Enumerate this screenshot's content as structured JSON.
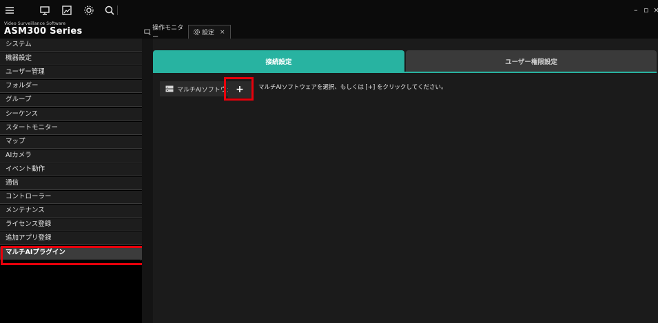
{
  "app": {
    "subtitle": "Video Surveillance Software",
    "title": "ASM300 Series"
  },
  "topbar": {
    "icons": [
      "menu-icon",
      "monitor-icon",
      "image-icon",
      "gear-icon",
      "search-icon"
    ],
    "window_controls": {
      "minimize": "–",
      "maximize": "▫",
      "close": "×"
    }
  },
  "tabs": [
    {
      "label": "操作モニター",
      "icon": "monitor-icon"
    },
    {
      "label": "設定",
      "icon": "gear-icon",
      "close": "×"
    }
  ],
  "sidebar": {
    "items": [
      {
        "label": "システム"
      },
      {
        "label": "機器設定"
      },
      {
        "label": "ユーザー管理"
      },
      {
        "label": "フォルダー"
      },
      {
        "label": "グループ"
      },
      {
        "label": "シーケンス"
      },
      {
        "label": "スタートモニター"
      },
      {
        "label": "マップ"
      },
      {
        "label": "AIカメラ"
      },
      {
        "label": "イベント動作"
      },
      {
        "label": "通信"
      },
      {
        "label": "コントローラー"
      },
      {
        "label": "メンテナンス"
      },
      {
        "label": "ライセンス登録"
      },
      {
        "label": "追加アプリ登録"
      },
      {
        "label": "マルチAIプラグイン"
      }
    ],
    "active_index": 15
  },
  "content": {
    "tabs": [
      {
        "label": "接続設定"
      },
      {
        "label": "ユーザー権限設定"
      }
    ],
    "software_item": {
      "label": "マルチAIソフトウェア",
      "icon": "server-icon"
    },
    "add_button": {
      "label": "+"
    },
    "hint": "マルチAIソフトウェアを選択、もしくは [+] をクリックしてください。"
  },
  "colors": {
    "accent": "#28b3a1",
    "highlight_box": "#e8000b",
    "background": "#1b1b1b",
    "sidebar_background": "#000000"
  }
}
